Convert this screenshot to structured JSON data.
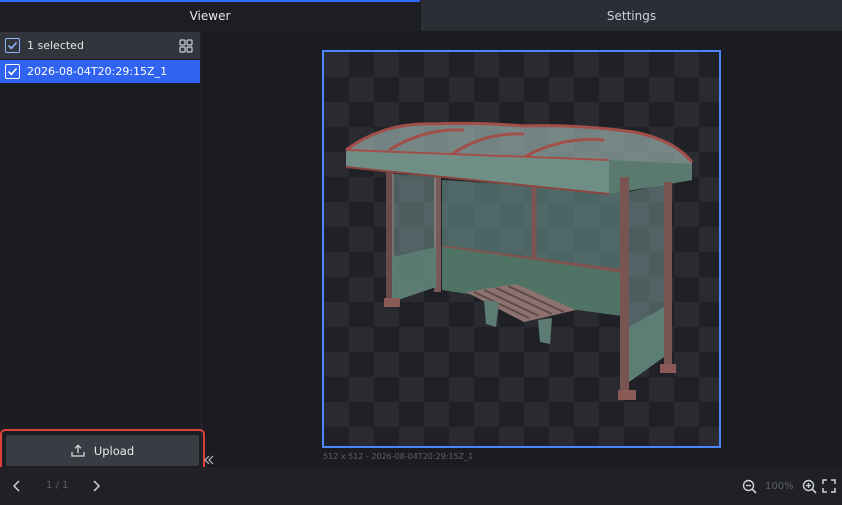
{
  "tabs": {
    "viewer": "Viewer",
    "settings": "Settings"
  },
  "sidebar": {
    "selected_label": "1 selected",
    "files": [
      {
        "name": "2026-08-04T20:29:15Z_1",
        "checked": true
      }
    ],
    "upload_label": "Upload"
  },
  "viewer": {
    "caption": "512 x 512 - 2026-08-04T20:29:15Z_1",
    "image_subject": "bus-shelter-3d-render"
  },
  "footer": {
    "pager": "1 / 1",
    "zoom": "100%"
  },
  "colors": {
    "accent": "#2f63f0",
    "frame_border": "#4a86ff",
    "highlight": "#e0403a"
  },
  "icons": [
    "check-icon",
    "grid-view-icon",
    "upload-icon",
    "collapse-left-icon",
    "chevron-left-icon",
    "chevron-right-icon",
    "zoom-out-icon",
    "zoom-in-icon",
    "fullscreen-icon"
  ]
}
